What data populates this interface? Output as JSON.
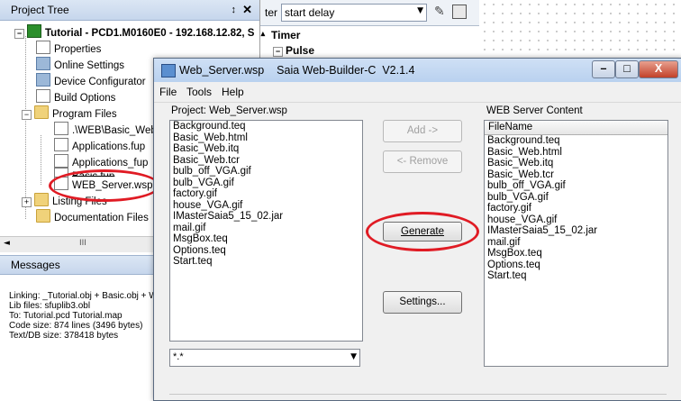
{
  "project_tree": {
    "title": "Project Tree",
    "pin_glyph": "↕",
    "close_glyph": "✕",
    "root_label": "Tutorial - PCD1.M0160E0 - 192.168.12.82, S",
    "root_scroll_glyph": "▴",
    "items": [
      {
        "label": "Properties"
      },
      {
        "label": "Online Settings"
      },
      {
        "label": "Device Configurator"
      },
      {
        "label": "Build Options"
      },
      {
        "label": "Program Files"
      },
      {
        "label": ".\\WEB\\Basic_Web.p"
      },
      {
        "label": "Applications.fup"
      },
      {
        "label": "Applications_fup"
      },
      {
        "label": "Basic.fup"
      },
      {
        "label": "WEB_Server.wsp"
      },
      {
        "label": "Listing Files"
      },
      {
        "label": "Documentation Files"
      }
    ],
    "hscroll_left": "◄",
    "hscroll_mid": "III"
  },
  "messages": {
    "title": "Messages",
    "lines": [
      "Linking: _Tutorial.obj + Basic.obj + WE",
      "Lib files: sfuplib3.obl",
      "To: Tutorial.pcd Tutorial.map",
      "Code size: 874 lines (3496 bytes)",
      "Text/DB size: 378418 bytes"
    ]
  },
  "background_pane": {
    "filter_prefix": "ter",
    "filter_value": "start delay",
    "timer_label": "Timer",
    "pulse_label": "Pulse"
  },
  "dialog": {
    "title": "Web_Server.wsp    Saia Web-Builder-C  V2.1.4",
    "menu": [
      "File",
      "Tools",
      "Help"
    ],
    "project_label": "Project: Web_Server.wsp",
    "project_files": [
      "Background.teq",
      "Basic_Web.html",
      "Basic_Web.itq",
      "Basic_Web.tcr",
      "bulb_off_VGA.gif",
      "bulb_VGA.gif",
      "factory.gif",
      "house_VGA.gif",
      "IMasterSaia5_15_02.jar",
      "mail.gif",
      "MsgBox.teq",
      "Options.teq",
      "Start.teq"
    ],
    "filter_value": "*.*",
    "buttons": {
      "add": "Add ->",
      "remove": "<- Remove",
      "generate": "Generate",
      "settings": "Settings..."
    },
    "server_label": "WEB Server Content",
    "server_header": "FileName",
    "server_files": [
      "Background.teq",
      "Basic_Web.html",
      "Basic_Web.itq",
      "Basic_Web.tcr",
      "bulb_off_VGA.gif",
      "bulb_VGA.gif",
      "factory.gif",
      "house_VGA.gif",
      "IMasterSaia5_15_02.jar",
      "mail.gif",
      "MsgBox.teq",
      "Options.teq",
      "Start.teq"
    ],
    "window_controls": {
      "minimize": "–",
      "maximize": "□",
      "close": "X"
    }
  },
  "colors": {
    "highlight_ellipse": "#e01b24",
    "title_gradient": "#b9d1ef"
  }
}
